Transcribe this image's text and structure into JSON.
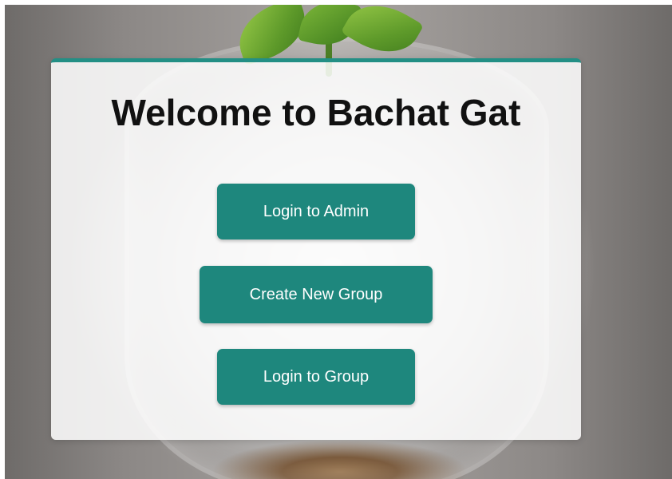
{
  "card": {
    "title": "Welcome to Bachat Gat"
  },
  "buttons": {
    "login_admin": "Login to Admin",
    "create_group": "Create New Group",
    "login_group": "Login to Group"
  },
  "colors": {
    "accent": "#1e877d",
    "card_border": "#238f85",
    "title_text": "#111111",
    "button_text": "#ffffff"
  },
  "background": {
    "icon": "plant-jar-photo"
  }
}
